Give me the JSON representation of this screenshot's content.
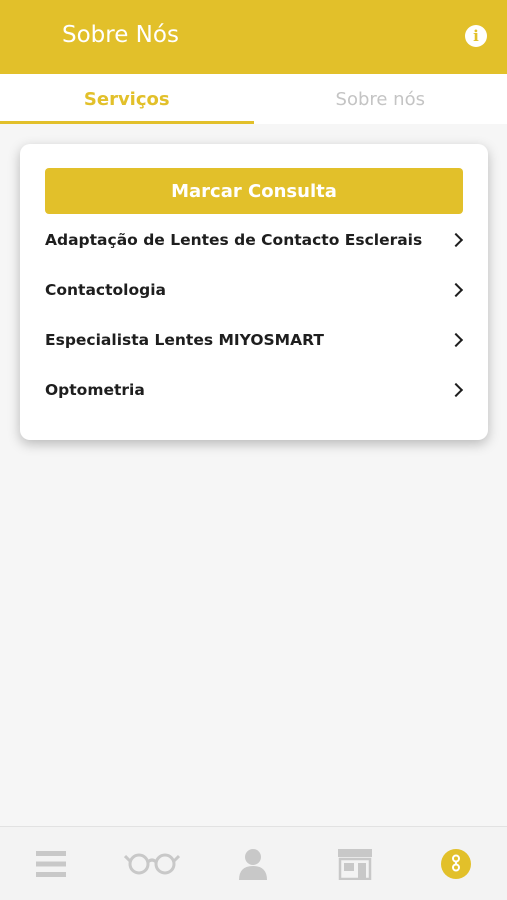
{
  "header": {
    "title": "Sobre Nós",
    "info_icon": "info-icon"
  },
  "tabs": [
    {
      "label": "Serviços",
      "active": true
    },
    {
      "label": "Sobre nós",
      "active": false
    }
  ],
  "card": {
    "book_label": "Marcar Consulta",
    "services": [
      {
        "label": "Adaptação de Lentes de Contacto Esclerais"
      },
      {
        "label": "Contactologia"
      },
      {
        "label": "Especialista Lentes MIYOSMART"
      },
      {
        "label": "Optometria"
      }
    ]
  },
  "bottom_nav": {
    "items": [
      {
        "icon": "menu-icon"
      },
      {
        "icon": "glasses-icon"
      },
      {
        "icon": "person-icon"
      },
      {
        "icon": "store-icon"
      },
      {
        "icon": "about-icon",
        "active": true
      }
    ]
  },
  "colors": {
    "accent": "#e2c02a",
    "text": "#1e1e1e",
    "inactive": "#c4c4c4"
  }
}
